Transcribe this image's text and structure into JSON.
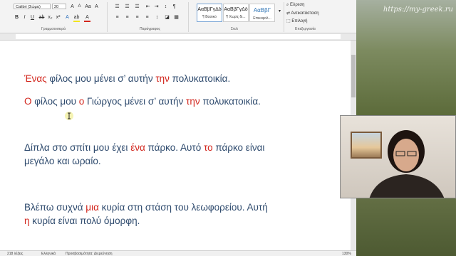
{
  "ribbon": {
    "font_name": "Calibri (Σώμα)",
    "font_size": "20",
    "groups": {
      "clipboard": "",
      "font": "Γραμματοσειρά",
      "paragraph": "Παράγραφος",
      "styles": "Στυλ",
      "editing": "Επεξεργασία"
    },
    "styles": [
      {
        "preview": "ΑαΒβΓγΔδ",
        "name": "¶ Βασικό"
      },
      {
        "preview": "ΑαΒβΓγΔδ",
        "name": "¶ Χωρίς δι..."
      },
      {
        "preview": "ΑαΒβΓ",
        "name": "Επικεφαλ..."
      }
    ],
    "editing": {
      "find": "Εύρεση",
      "replace": "Αντικατάσταση",
      "select": "Επιλογή"
    },
    "icons": [
      "bold-icon",
      "italic-icon",
      "underline-icon",
      "strikethrough-icon",
      "font-color-icon",
      "bullets-icon",
      "align-icon",
      "find-icon",
      "replace-icon",
      "select-icon",
      "cursor-icon"
    ]
  },
  "document": {
    "p1": {
      "t1": "Ένας",
      "t2": " φίλος μου μένει σ’ αυτήν ",
      "t3": "την",
      "t4": " πολυκατοικία."
    },
    "p2": {
      "t1": "Ο",
      "t2": " φίλος μου ",
      "t3": "ο",
      "t4": " Γιώργος μένει σ’ αυτήν ",
      "t5": "την",
      "t6": " πολυκατοικία."
    },
    "p3": {
      "t1": "Δίπλα στο σπίτι μου έχει ",
      "t2": "ένα",
      "t3": " πάρκο.  Αυτό ",
      "t4": "το",
      "t5": " πάρκο είναι",
      "t6": "μεγάλο και ωραίο."
    },
    "p4": {
      "t1": "Βλέπω συχνά ",
      "t2": "μια",
      "t3": " κυρία στη στάση του λεωφορείου. Αυτή",
      "t4": "η",
      "t5": " κυρία είναι πολύ όμορφη."
    }
  },
  "status": {
    "words": "218 λέξεις",
    "language": "Ελληνικά",
    "accessibility": "Προσβασιμότητα: Διερεύνηση",
    "zoom": "130%"
  },
  "video": {
    "watermark": "https://my-greek.ru"
  },
  "colors": {
    "text": "#2f4b6e",
    "article": "#d2261d"
  }
}
